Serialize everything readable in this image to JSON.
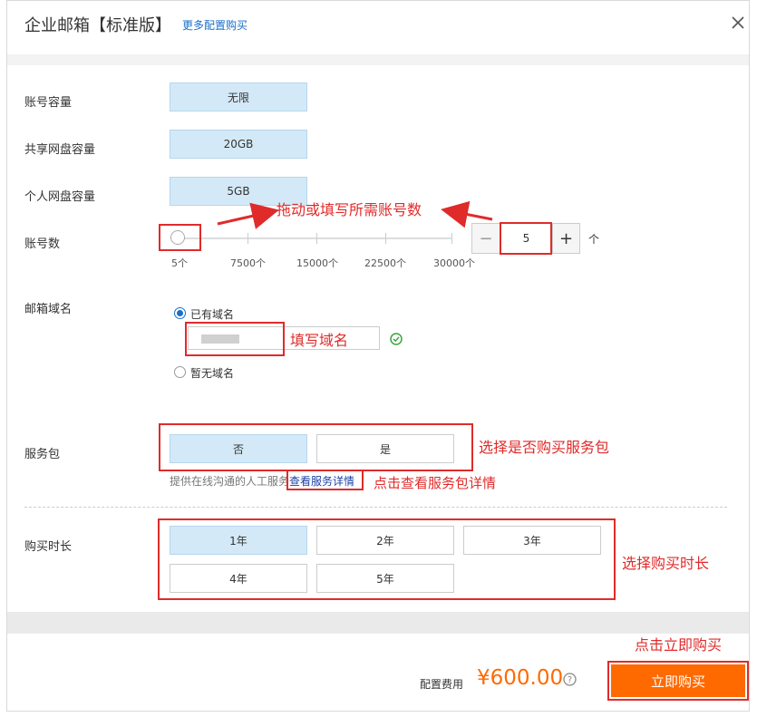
{
  "header": {
    "title": "企业邮箱【标准版】",
    "more_link": "更多配置购买"
  },
  "rows": {
    "account_capacity": {
      "label": "账号容量",
      "value": "无限"
    },
    "shared_disk": {
      "label": "共享网盘容量",
      "value": "20GB"
    },
    "personal_disk": {
      "label": "个人网盘容量",
      "value": "5GB"
    },
    "accounts": {
      "label": "账号数",
      "ticks": [
        "5个",
        "7500个",
        "15000个",
        "22500个",
        "30000个"
      ],
      "value": "5",
      "unit": "个",
      "minus": "−",
      "plus": "+"
    },
    "domain": {
      "label": "邮箱域名",
      "opt_existing": "已有域名",
      "opt_none": "暂无域名",
      "selected": "已有域名"
    },
    "service_pack": {
      "label": "服务包",
      "options": [
        "否",
        "是"
      ],
      "selected": "否",
      "note": "提供在线沟通的人工服务",
      "details_link": "查看服务详情"
    },
    "duration": {
      "label": "购买时长",
      "options": [
        "1年",
        "2年",
        "3年",
        "4年",
        "5年"
      ],
      "selected": "1年"
    }
  },
  "annotations": {
    "drag_fill": "拖动或填写所需账号数",
    "fill_domain": "填写域名",
    "choose_pack": "选择是否购买服务包",
    "view_pack": "点击查看服务包详情",
    "choose_duration": "选择购买时长",
    "click_buy": "点击立即购买"
  },
  "footer": {
    "fee_label": "配置费用",
    "price": "¥600.00",
    "buy_button": "立即购买"
  },
  "colors": {
    "accent_orange": "#ff6a00",
    "annotation_red": "#e02b2b",
    "selected_blue": "#d4e9f7",
    "link_blue": "#1a6fc9"
  }
}
